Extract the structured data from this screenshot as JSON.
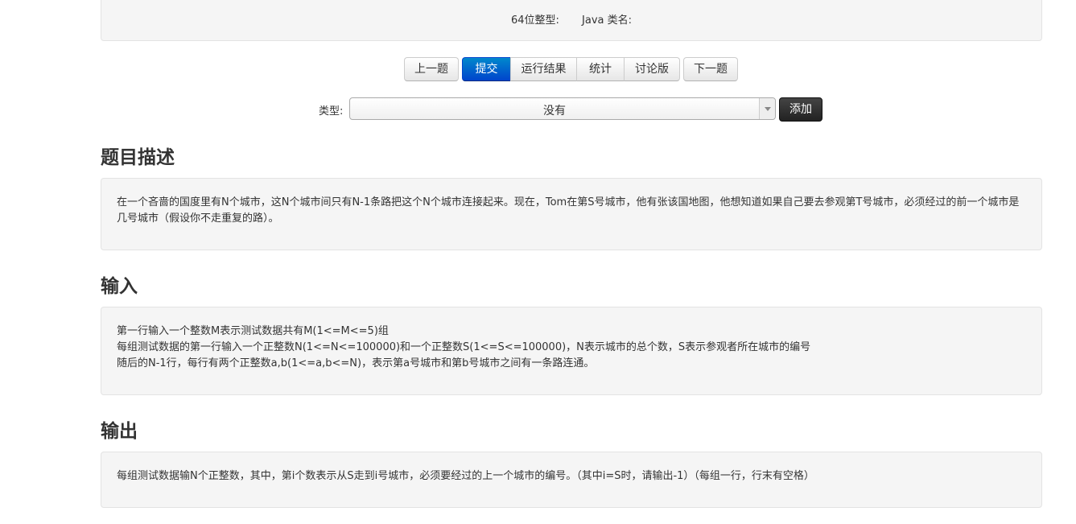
{
  "info": {
    "int64": "64位整型:",
    "java_class": "Java 类名:"
  },
  "toolbar": {
    "prev": "上一题",
    "submit": "提交",
    "results": "运行结果",
    "stats": "统计",
    "discuss": "讨论版",
    "next": "下一题"
  },
  "type_row": {
    "label": "类型:",
    "selected": "没有",
    "add": "添加"
  },
  "sections": {
    "description": {
      "title": "题目描述",
      "text": "在一个吝啬的国度里有N个城市，这N个城市间只有N-1条路把这个N个城市连接起来。现在，Tom在第S号城市，他有张该国地图，他想知道如果自己要去参观第T号城市，必须经过的前一个城市是几号城市（假设你不走重复的路）。"
    },
    "input": {
      "title": "输入",
      "lines": [
        "第一行输入一个整数M表示测试数据共有M(1<=M<=5)组",
        "每组测试数据的第一行输入一个正整数N(1<=N<=100000)和一个正整数S(1<=S<=100000)，N表示城市的总个数，S表示参观者所在城市的编号",
        "随后的N-1行，每行有两个正整数a,b(1<=a,b<=N)，表示第a号城市和第b号城市之间有一条路连通。"
      ]
    },
    "output": {
      "title": "输出",
      "text": "每组测试数据输N个正整数，其中，第i个数表示从S走到i号城市，必须要经过的上一个城市的编号。（其中i=S时，请输出-1）（每组一行，行末有空格）"
    }
  }
}
